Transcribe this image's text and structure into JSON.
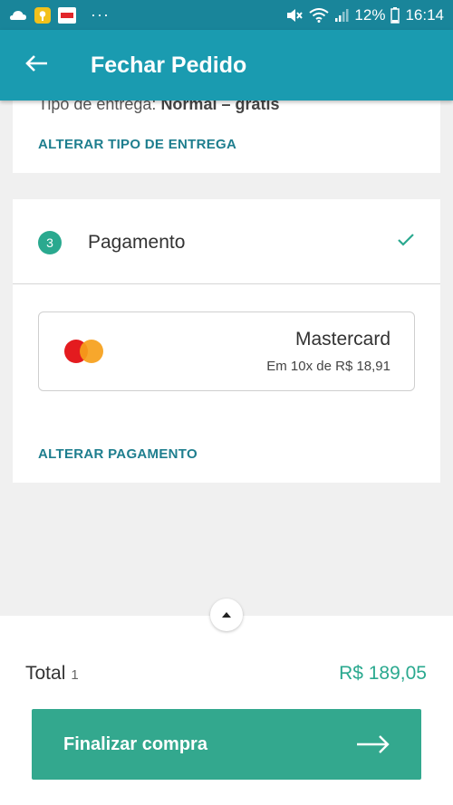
{
  "status_bar": {
    "battery": "12%",
    "time": "16:14",
    "dots": "···"
  },
  "app_bar": {
    "title": "Fechar Pedido"
  },
  "delivery": {
    "type_label": "Tipo de entrega:",
    "type_value": "Normal – grátis",
    "change_link": "ALTERAR TIPO DE ENTREGA"
  },
  "payment": {
    "step_number": "3",
    "title": "Pagamento",
    "method_name": "Mastercard",
    "installments": "Em 10x de R$ 18,91",
    "change_link": "ALTERAR PAGAMENTO"
  },
  "summary": {
    "total_label": "Total",
    "item_count": "1",
    "total_value": "R$ 189,05"
  },
  "cta": {
    "label": "Finalizar compra"
  },
  "colors": {
    "status_bar": "#19859a",
    "app_bar": "#1a9bb0",
    "accent": "#2aa98f",
    "cta": "#33a88e",
    "link": "#1e7e8e"
  },
  "icons": [
    "back-arrow-icon",
    "check-icon",
    "mastercard-logo-icon",
    "chevron-up-icon",
    "arrow-right-icon"
  ]
}
